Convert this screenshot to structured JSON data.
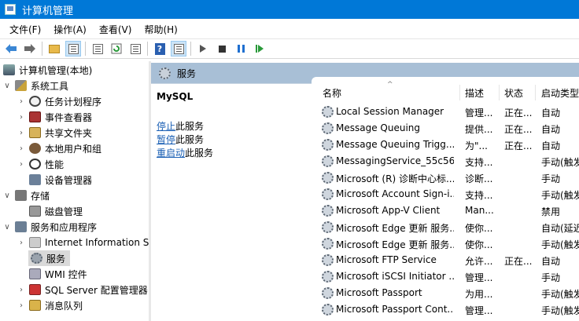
{
  "window": {
    "title": "计算机管理"
  },
  "menu": [
    "文件(F)",
    "操作(A)",
    "查看(V)",
    "帮助(H)"
  ],
  "toolbar": {
    "back": "back-arrow-icon",
    "forward": "forward-arrow-icon",
    "up": "folder-up-icon",
    "show_tree": "show-tree-icon",
    "properties": "properties-icon",
    "refresh": "refresh-icon",
    "export": "export-list-icon",
    "help": "help-icon",
    "help_glyph": "?",
    "view": "view-toggle-icon",
    "start": "start-icon",
    "stop": "stop-icon",
    "pause": "pause-icon",
    "restart": "restart-icon"
  },
  "tree": [
    {
      "label": "计算机管理(本地)",
      "chev": "",
      "icon": "root",
      "level": 0
    },
    {
      "label": "系统工具",
      "chev": "∨",
      "icon": "tools",
      "level": 1
    },
    {
      "label": "任务计划程序",
      "chev": "›",
      "icon": "clock",
      "level": 2
    },
    {
      "label": "事件查看器",
      "chev": "›",
      "icon": "event",
      "level": 2
    },
    {
      "label": "共享文件夹",
      "chev": "›",
      "icon": "share",
      "level": 2
    },
    {
      "label": "本地用户和组",
      "chev": "›",
      "icon": "users",
      "level": 2
    },
    {
      "label": "性能",
      "chev": "›",
      "icon": "perf",
      "level": 2
    },
    {
      "label": "设备管理器",
      "chev": "",
      "icon": "device",
      "level": 2
    },
    {
      "label": "存储",
      "chev": "∨",
      "icon": "storage",
      "level": 1
    },
    {
      "label": "磁盘管理",
      "chev": "",
      "icon": "disk",
      "level": 2
    },
    {
      "label": "服务和应用程序",
      "chev": "∨",
      "icon": "svcapp",
      "level": 1
    },
    {
      "label": "Internet Information S",
      "chev": "›",
      "icon": "iis",
      "level": 2
    },
    {
      "label": "服务",
      "chev": "",
      "icon": "gear",
      "level": 2,
      "selected": true
    },
    {
      "label": "WMI 控件",
      "chev": "",
      "icon": "wmi",
      "level": 2
    },
    {
      "label": "SQL Server 配置管理器",
      "chev": "›",
      "icon": "sql",
      "level": 2
    },
    {
      "label": "消息队列",
      "chev": "›",
      "icon": "queue",
      "level": 2
    }
  ],
  "services_header": "服务",
  "detail": {
    "service_name": "MySQL",
    "actions": [
      {
        "link": "停止",
        "suffix": "此服务"
      },
      {
        "link": "暂停",
        "suffix": "此服务"
      },
      {
        "link": "重启动",
        "suffix": "此服务"
      }
    ]
  },
  "columns": [
    "名称",
    "描述",
    "状态",
    "启动类型"
  ],
  "sort_arrow": "^",
  "services": [
    {
      "name": "Local Session Manager",
      "desc": "管理...",
      "status": "正在...",
      "startup": "自动"
    },
    {
      "name": "Message Queuing",
      "desc": "提供...",
      "status": "正在...",
      "startup": "自动"
    },
    {
      "name": "Message Queuing Trigg...",
      "desc": "为\"...",
      "status": "正在...",
      "startup": "自动"
    },
    {
      "name": "MessagingService_55c56",
      "desc": "支持...",
      "status": "",
      "startup": "手动(触发"
    },
    {
      "name": "Microsoft (R) 诊断中心标...",
      "desc": "诊断...",
      "status": "",
      "startup": "手动"
    },
    {
      "name": "Microsoft Account Sign-i...",
      "desc": "支持...",
      "status": "",
      "startup": "手动(触发"
    },
    {
      "name": "Microsoft App-V Client",
      "desc": "Man...",
      "status": "",
      "startup": "禁用"
    },
    {
      "name": "Microsoft Edge 更新 服务...",
      "desc": "使你...",
      "status": "",
      "startup": "自动(延迟"
    },
    {
      "name": "Microsoft Edge 更新 服务...",
      "desc": "使你...",
      "status": "",
      "startup": "手动(触发"
    },
    {
      "name": "Microsoft FTP Service",
      "desc": "允许...",
      "status": "正在...",
      "startup": "自动"
    },
    {
      "name": "Microsoft iSCSI Initiator ...",
      "desc": "管理...",
      "status": "",
      "startup": "手动"
    },
    {
      "name": "Microsoft Passport",
      "desc": "为用...",
      "status": "",
      "startup": "手动(触发"
    },
    {
      "name": "Microsoft Passport Cont...",
      "desc": "管理...",
      "status": "",
      "startup": "手动(触发"
    }
  ]
}
